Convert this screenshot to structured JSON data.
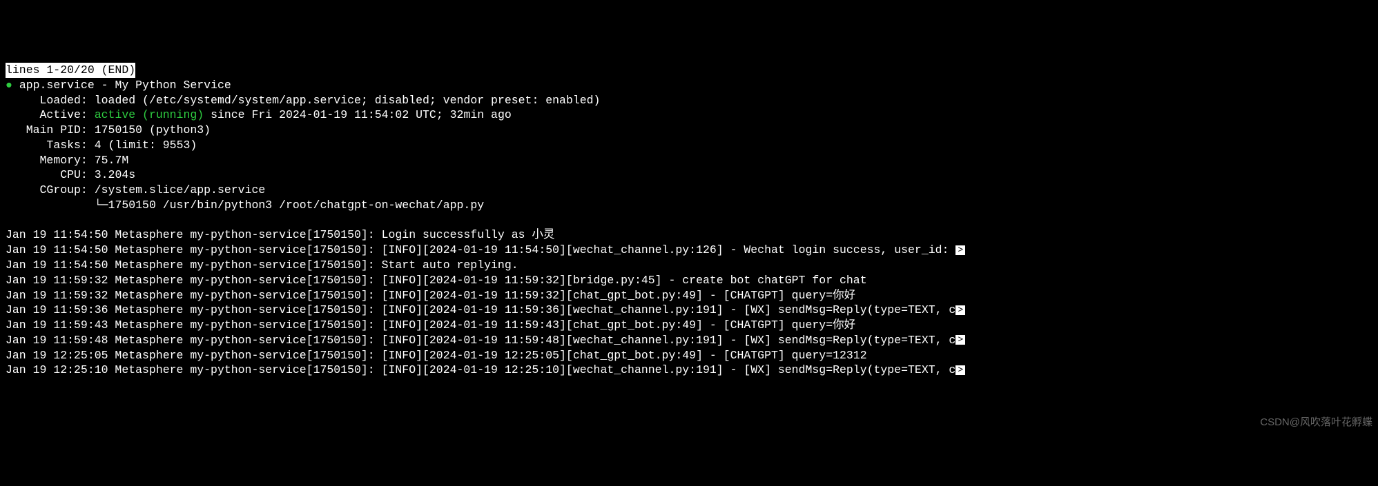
{
  "pager": "lines 1-20/20 (END)",
  "header": {
    "bullet": "●",
    "unit_name": "app.service",
    "unit_desc": "My Python Service",
    "loaded_label": "Loaded:",
    "loaded_value": "loaded (/etc/systemd/system/app.service; disabled; vendor preset: enabled)",
    "active_label": "Active:",
    "active_state": "active (running)",
    "active_since": "since Fri 2024-01-19 11:54:02 UTC; 32min ago",
    "main_pid_label": "Main PID:",
    "main_pid_value": "1750150 (python3)",
    "tasks_label": "Tasks:",
    "tasks_value": "4 (limit: 9553)",
    "memory_label": "Memory:",
    "memory_value": "75.7M",
    "cpu_label": "CPU:",
    "cpu_value": "3.204s",
    "cgroup_label": "CGroup:",
    "cgroup_value": "/system.slice/app.service",
    "cgroup_tree": "└─1750150 /usr/bin/python3 /root/chatgpt-on-wechat/app.py"
  },
  "logs": [
    {
      "text": "Jan 19 11:54:50 Metasphere my-python-service[1750150]: Login successfully as 小灵",
      "overflow": false
    },
    {
      "text": "Jan 19 11:54:50 Metasphere my-python-service[1750150]: [INFO][2024-01-19 11:54:50][wechat_channel.py:126] - Wechat login success, user_id: ",
      "overflow": true
    },
    {
      "text": "Jan 19 11:54:50 Metasphere my-python-service[1750150]: Start auto replying.",
      "overflow": false
    },
    {
      "text": "Jan 19 11:59:32 Metasphere my-python-service[1750150]: [INFO][2024-01-19 11:59:32][bridge.py:45] - create bot chatGPT for chat",
      "overflow": false
    },
    {
      "text": "Jan 19 11:59:32 Metasphere my-python-service[1750150]: [INFO][2024-01-19 11:59:32][chat_gpt_bot.py:49] - [CHATGPT] query=你好",
      "overflow": false
    },
    {
      "text": "Jan 19 11:59:36 Metasphere my-python-service[1750150]: [INFO][2024-01-19 11:59:36][wechat_channel.py:191] - [WX] sendMsg=Reply(type=TEXT, c",
      "overflow": true
    },
    {
      "text": "Jan 19 11:59:43 Metasphere my-python-service[1750150]: [INFO][2024-01-19 11:59:43][chat_gpt_bot.py:49] - [CHATGPT] query=你好",
      "overflow": false
    },
    {
      "text": "Jan 19 11:59:48 Metasphere my-python-service[1750150]: [INFO][2024-01-19 11:59:48][wechat_channel.py:191] - [WX] sendMsg=Reply(type=TEXT, c",
      "overflow": true
    },
    {
      "text": "Jan 19 12:25:05 Metasphere my-python-service[1750150]: [INFO][2024-01-19 12:25:05][chat_gpt_bot.py:49] - [CHATGPT] query=12312",
      "overflow": false
    },
    {
      "text": "Jan 19 12:25:10 Metasphere my-python-service[1750150]: [INFO][2024-01-19 12:25:10][wechat_channel.py:191] - [WX] sendMsg=Reply(type=TEXT, c",
      "overflow": true
    }
  ],
  "watermark": "CSDN@风吹落叶花孵蝶"
}
